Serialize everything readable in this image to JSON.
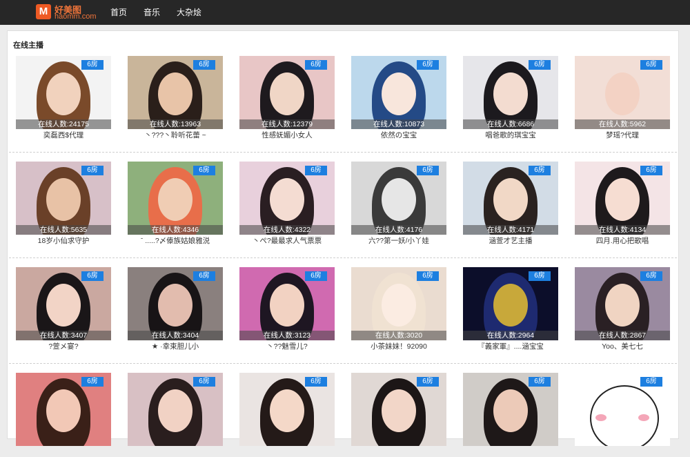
{
  "logo": {
    "cn": "好美图",
    "en": "haomm.com",
    "icon": "m-logo-icon"
  },
  "nav": [
    {
      "label": "首页"
    },
    {
      "label": "音乐"
    },
    {
      "label": "大杂烩"
    }
  ],
  "section": {
    "title": "在线主播"
  },
  "cards": [
    {
      "room": "6房",
      "viewers": "在线人数:24175",
      "name": "奕磊西$代理",
      "colors": [
        "#f3f3f3",
        "#7a4a2a",
        "#f1d2bd"
      ]
    },
    {
      "room": "6房",
      "viewers": "在线人数:13963",
      "name": "丶???丶聆听花蕾 ~",
      "colors": [
        "#c9b59a",
        "#2a1f1a",
        "#e8c4a8"
      ]
    },
    {
      "room": "6房",
      "viewers": "在线人数:12379",
      "name": "性感妩媚小女人",
      "colors": [
        "#e8c6c6",
        "#1e1a1e",
        "#f0d6c6"
      ]
    },
    {
      "room": "6房",
      "viewers": "在线人数:10873",
      "name": "依然の宝宝",
      "colors": [
        "#bcd8ec",
        "#244a86",
        "#f8e6dc"
      ]
    },
    {
      "room": "6房",
      "viewers": "在线人数:6686",
      "name": "唱爸歌的琪宝宝",
      "colors": [
        "#e6e6ea",
        "#1c1a1e",
        "#f3dcd0"
      ]
    },
    {
      "room": "6房",
      "viewers": "在线人数:5962",
      "name": "梦瑶?代理",
      "colors": [
        "#f2ded6",
        "#f2ded6",
        "#f3d2c4"
      ]
    },
    {
      "room": "6房",
      "viewers": "在线人数:5635",
      "name": "18岁小仙求守护",
      "colors": [
        "#d7c0c8",
        "#6a4028",
        "#e8c2a6"
      ]
    },
    {
      "room": "6房",
      "viewers": "在线人数:4346",
      "name": "ˉ .....?〆傣族姑娘雅涚",
      "colors": [
        "#8eb07c",
        "#e86e4a",
        "#f0cdb4"
      ]
    },
    {
      "room": "6房",
      "viewers": "在线人数:4322",
      "name": "丶ぺ?最最求人气票票",
      "colors": [
        "#e8d0dc",
        "#2a1e22",
        "#f4dcd2"
      ]
    },
    {
      "room": "6房",
      "viewers": "在线人数:4176",
      "name": "六??第一妖/小丫娃",
      "colors": [
        "#d8d8d8",
        "#3a3a3a",
        "#e6e6e6"
      ]
    },
    {
      "room": "6房",
      "viewers": "在线人数:4171",
      "name": "涵萱才艺主播",
      "colors": [
        "#d2dce6",
        "#2a2220",
        "#f1d8c6"
      ]
    },
    {
      "room": "6房",
      "viewers": "在线人数:4134",
      "name": "四月.用心把歌唱",
      "colors": [
        "#f4e4e6",
        "#1e1a1c",
        "#f6ddd2"
      ]
    },
    {
      "room": "6房",
      "viewers": "在线人数:3407",
      "name": "?萱メ宴?",
      "colors": [
        "#caa8a0",
        "#1a1618",
        "#f2d4c6"
      ]
    },
    {
      "room": "6房",
      "viewers": "在线人数:3404",
      "name": "★ ·幸束胆儿小",
      "colors": [
        "#8a807e",
        "#181416",
        "#e2bcae"
      ]
    },
    {
      "room": "6房",
      "viewers": "在线人数:3123",
      "name": "丶??魅雪儿?",
      "colors": [
        "#d06ab0",
        "#1e1622",
        "#f2d2c2"
      ]
    },
    {
      "room": "6房",
      "viewers": "在线人数:3020",
      "name": "小茶妹妹！92090",
      "colors": [
        "#eadcd0",
        "#f0e2d2",
        "#fbece2"
      ]
    },
    {
      "room": "6房",
      "viewers": "在线人数:2964",
      "name": "『義家軍』....涵宝宝",
      "colors": [
        "#0c0e2a",
        "#1e2a70",
        "#c8a83a"
      ]
    },
    {
      "room": "6房",
      "viewers": "在线人数:2867",
      "name": "Yoo、美七七",
      "colors": [
        "#9a8aa0",
        "#2a2024",
        "#f0d4c2"
      ]
    },
    {
      "room": "6房",
      "viewers": "",
      "name": "",
      "colors": [
        "#e08080",
        "#3a2018",
        "#f2c8b6"
      ]
    },
    {
      "room": "6房",
      "viewers": "",
      "name": "",
      "colors": [
        "#d8c0c4",
        "#2a1e1e",
        "#f1d2c4"
      ]
    },
    {
      "room": "6房",
      "viewers": "",
      "name": "",
      "colors": [
        "#eae4e2",
        "#241a18",
        "#f4d8c8"
      ]
    },
    {
      "room": "6房",
      "viewers": "",
      "name": "",
      "colors": [
        "#e0d8d4",
        "#1c1616",
        "#f2d6c8"
      ]
    },
    {
      "room": "6房",
      "viewers": "",
      "name": "",
      "colors": [
        "#d0ccc8",
        "#1e1818",
        "#eccab8"
      ]
    },
    {
      "room": "6房",
      "viewers": "",
      "name": "",
      "colors": [
        "#ffffff",
        "#ffffff",
        "#ffffff"
      ]
    }
  ]
}
